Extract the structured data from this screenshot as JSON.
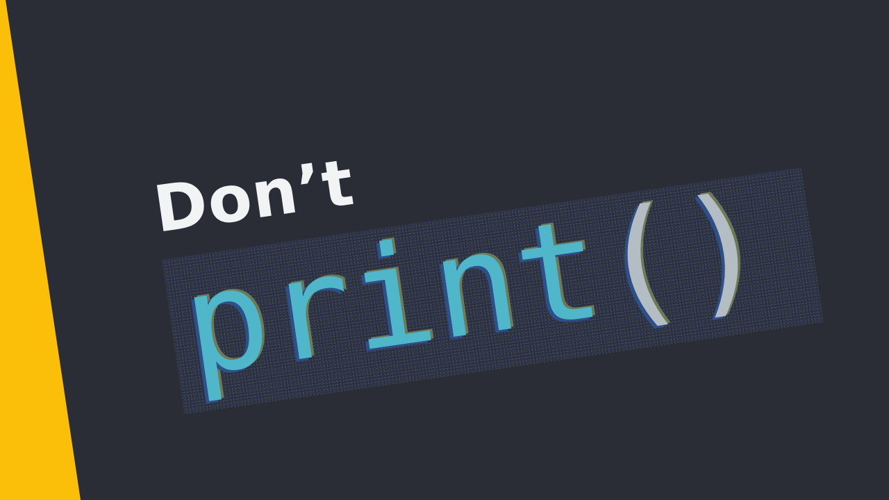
{
  "headline": "Don’t",
  "code": {
    "function_name": "print",
    "parentheses": "()"
  },
  "colors": {
    "background": "#2a2d36",
    "accent": "#fbbf0a",
    "code_function": "#4fb7c9",
    "code_parens": "#b4bcc4",
    "headline": "#f2f3f5"
  }
}
